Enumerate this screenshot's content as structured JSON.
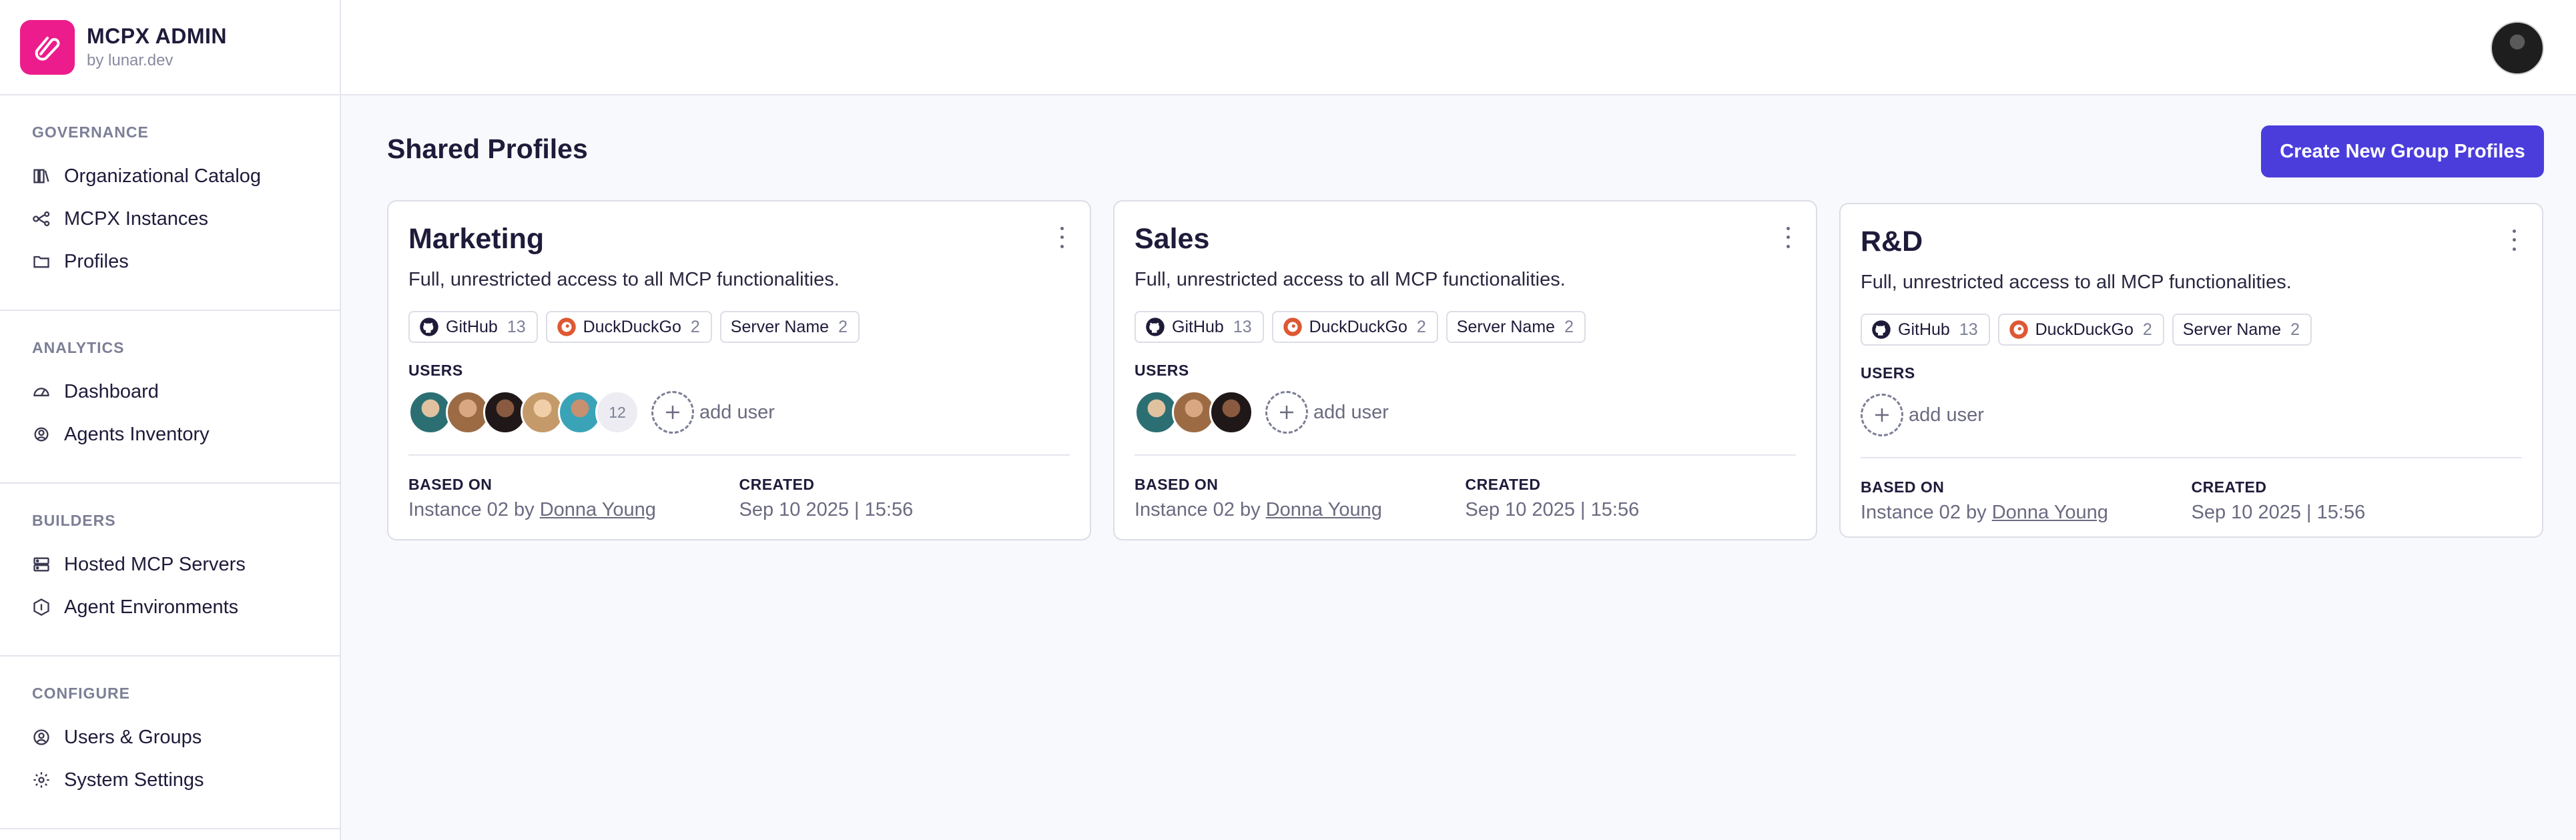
{
  "app": {
    "title": "MCPX ADMIN",
    "subtitle": "by lunar.dev",
    "brand_color": "#ec1c8c"
  },
  "sidebar": {
    "sections": [
      {
        "heading": "GOVERNANCE",
        "items": [
          {
            "label": "Organizational Catalog",
            "icon": "catalog-icon"
          },
          {
            "label": "MCPX Instances",
            "icon": "instances-icon"
          },
          {
            "label": "Profiles",
            "icon": "folder-icon"
          }
        ]
      },
      {
        "heading": "ANALYTICS",
        "items": [
          {
            "label": "Dashboard",
            "icon": "dashboard-icon"
          },
          {
            "label": "Agents Inventory",
            "icon": "agents-icon"
          }
        ]
      },
      {
        "heading": "BUILDERS",
        "items": [
          {
            "label": "Hosted MCP Servers",
            "icon": "servers-icon"
          },
          {
            "label": "Agent Environments",
            "icon": "environments-icon"
          }
        ]
      },
      {
        "heading": "CONFIGURE",
        "items": [
          {
            "label": "Users & Groups",
            "icon": "users-icon"
          },
          {
            "label": "System Settings",
            "icon": "gear-icon"
          }
        ]
      }
    ]
  },
  "main": {
    "title": "Shared Profiles",
    "create_button": "Create New Group Profiles",
    "accent_color": "#4b3ddc",
    "users_label": "USERS",
    "add_user_label": "add user",
    "based_on_label": "BASED ON",
    "created_label": "CREATED",
    "cards": [
      {
        "name": "Marketing",
        "description": "Full, unrestricted access to all MCP functionalities.",
        "servers": [
          {
            "name": "GitHub",
            "count": "13",
            "icon": "github-icon"
          },
          {
            "name": "DuckDuckGo",
            "count": "2",
            "icon": "duckduckgo-icon"
          },
          {
            "name": "Server Name",
            "count": "2",
            "icon": ""
          }
        ],
        "extra_users": "12",
        "based_on_prefix": "Instance 02 by",
        "based_on_author": "Donna Young",
        "created": "Sep 10 2025 | 15:56"
      },
      {
        "name": "Sales",
        "description": "Full, unrestricted access to all MCP functionalities.",
        "servers": [
          {
            "name": "GitHub",
            "count": "13",
            "icon": "github-icon"
          },
          {
            "name": "DuckDuckGo",
            "count": "2",
            "icon": "duckduckgo-icon"
          },
          {
            "name": "Server Name",
            "count": "2",
            "icon": ""
          }
        ],
        "based_on_prefix": "Instance 02 by",
        "based_on_author": "Donna Young",
        "created": "Sep 10 2025 | 15:56"
      },
      {
        "name": "R&D",
        "description": "Full, unrestricted access to all MCP functionalities.",
        "servers": [
          {
            "name": "GitHub",
            "count": "13",
            "icon": "github-icon"
          },
          {
            "name": "DuckDuckGo",
            "count": "2",
            "icon": "duckduckgo-icon"
          },
          {
            "name": "Server Name",
            "count": "2",
            "icon": ""
          }
        ],
        "based_on_prefix": "Instance 02 by",
        "based_on_author": "Donna Young",
        "created": "Sep 10 2025 | 15:56"
      }
    ]
  }
}
